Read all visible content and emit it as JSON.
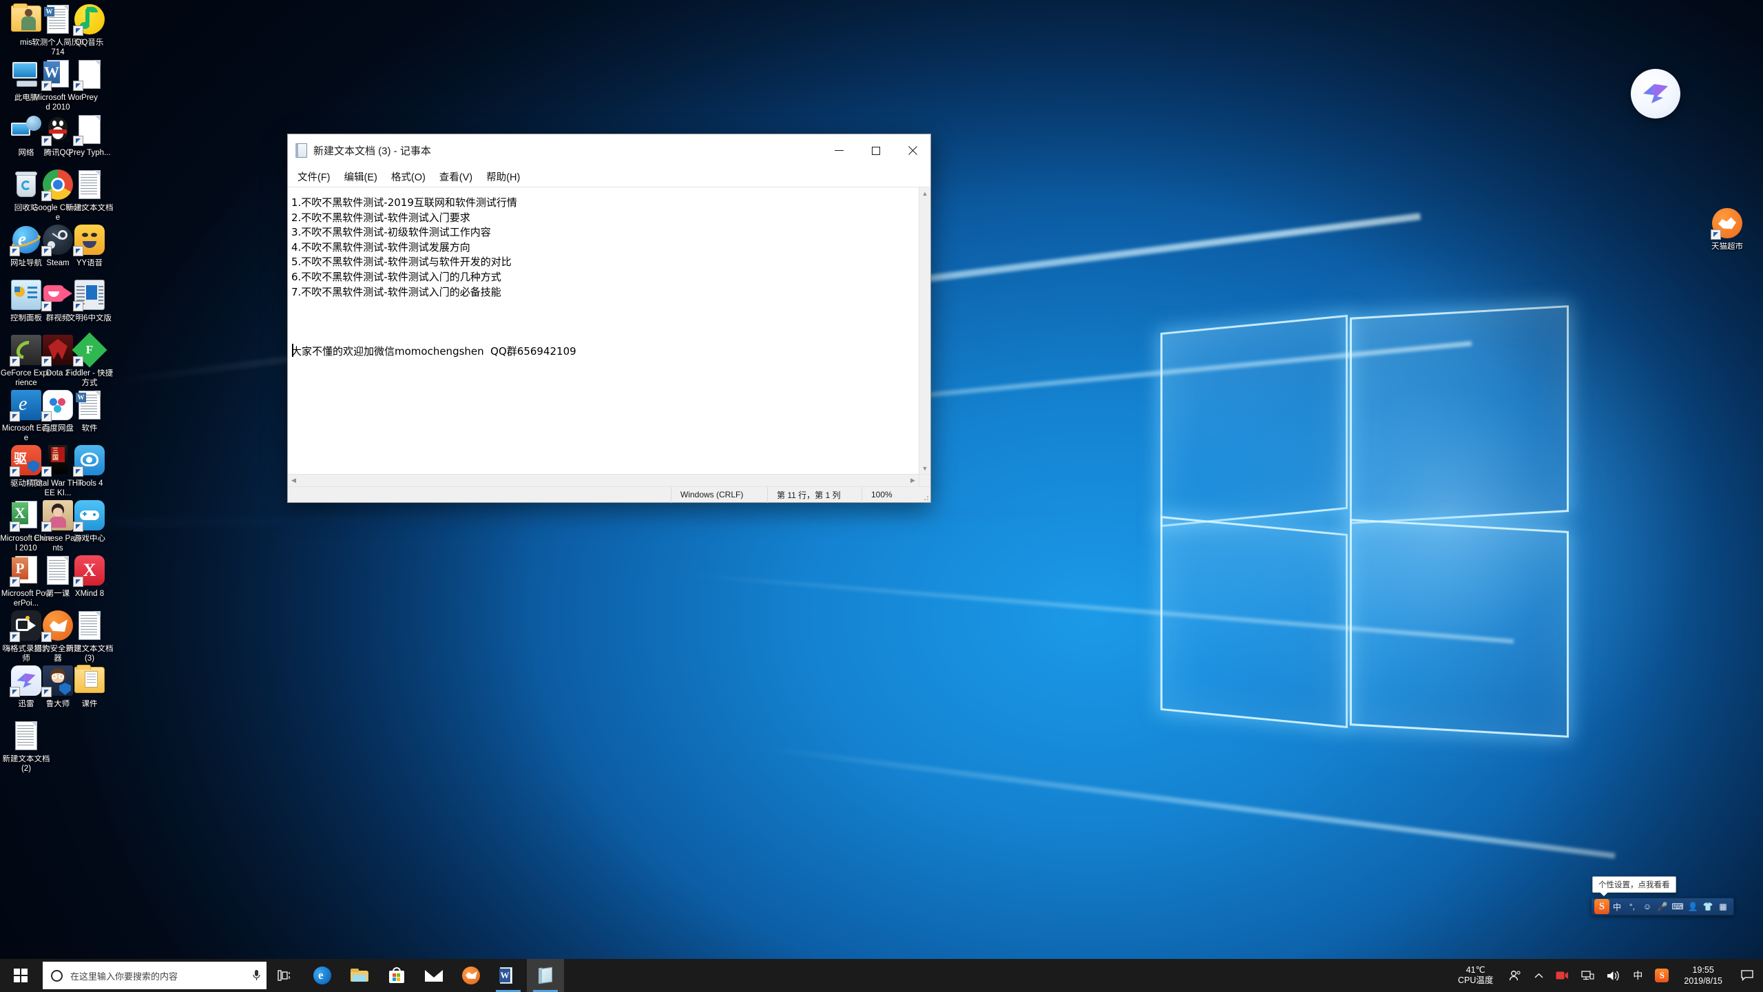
{
  "desktop": {
    "icons": [
      {
        "label": "mis",
        "type": "folder-user"
      },
      {
        "label": "软测个人简历0714",
        "type": "word-doc"
      },
      {
        "label": "QQ音乐",
        "type": "qqmusic",
        "shortcut": true
      },
      {
        "label": "此电脑",
        "type": "this-pc"
      },
      {
        "label": "Microsoft Word 2010",
        "type": "word-app",
        "shortcut": true
      },
      {
        "label": "Prey",
        "type": "blank-doc",
        "shortcut": true
      },
      {
        "label": "网络",
        "type": "network"
      },
      {
        "label": "腾讯QQ",
        "type": "qq-penguin",
        "shortcut": true
      },
      {
        "label": "Prey Typh...",
        "type": "blank-doc",
        "shortcut": true
      },
      {
        "label": "回收站",
        "type": "recycle-bin"
      },
      {
        "label": "Google Chrome",
        "type": "chrome",
        "shortcut": true
      },
      {
        "label": "新建文本文档",
        "type": "text-doc"
      },
      {
        "label": "网址导航",
        "type": "ie",
        "shortcut": true
      },
      {
        "label": "Steam",
        "type": "steam",
        "shortcut": true
      },
      {
        "label": "YY语音",
        "type": "yy",
        "shortcut": true
      },
      {
        "label": "控制面板",
        "type": "control-panel"
      },
      {
        "label": "群视频",
        "type": "qun-video",
        "shortcut": true
      },
      {
        "label": "文明6中文版",
        "type": "civ6",
        "shortcut": true
      },
      {
        "label": "GeForce Experience",
        "type": "geforce",
        "shortcut": true
      },
      {
        "label": "Dota 2",
        "type": "dota2",
        "shortcut": true
      },
      {
        "label": "Fiddler - 快捷方式",
        "type": "fiddler",
        "shortcut": true
      },
      {
        "label": "Microsoft Edge",
        "type": "edge",
        "shortcut": true
      },
      {
        "label": "百度网盘",
        "type": "baidu-pan",
        "shortcut": true
      },
      {
        "label": "软件",
        "type": "word-doc"
      },
      {
        "label": "驱动精灵",
        "type": "qudong",
        "shortcut": true
      },
      {
        "label": "Total War THREE KI...",
        "type": "totalwar",
        "shortcut": true
      },
      {
        "label": "iTools 4",
        "type": "itools",
        "shortcut": true
      },
      {
        "label": "Microsoft Excel 2010",
        "type": "excel-app",
        "shortcut": true
      },
      {
        "label": "Chinese Parents",
        "type": "chinese-parents",
        "shortcut": true
      },
      {
        "label": "游戏中心",
        "type": "game-center",
        "shortcut": true
      },
      {
        "label": "Microsoft PowerPoi...",
        "type": "ppt-app",
        "shortcut": true
      },
      {
        "label": "第一课",
        "type": "text-doc"
      },
      {
        "label": "XMind 8",
        "type": "xmind",
        "shortcut": true
      },
      {
        "label": "嗨格式录屏大师",
        "type": "haigeshi",
        "shortcut": true
      },
      {
        "label": "猎豹安全浏览器",
        "type": "liebao",
        "shortcut": true
      },
      {
        "label": "新建文本文档 (3)",
        "type": "text-doc"
      },
      {
        "label": "迅雷",
        "type": "xunlei",
        "shortcut": true
      },
      {
        "label": "鲁大师",
        "type": "ludashi",
        "shortcut": true
      },
      {
        "label": "课件",
        "type": "folder-doc"
      },
      {
        "label": "新建文本文档 (2)",
        "type": "text-doc"
      }
    ],
    "right_icons": [
      {
        "label": "天猫超市",
        "type": "tmall",
        "shortcut": true
      }
    ],
    "xunlei_widget_name": "xunlei-floating-widget"
  },
  "notepad": {
    "title": "新建文本文档 (3) - 记事本",
    "menus": [
      {
        "label": "文件(F)"
      },
      {
        "label": "编辑(E)"
      },
      {
        "label": "格式(O)"
      },
      {
        "label": "查看(V)"
      },
      {
        "label": "帮助(H)"
      }
    ],
    "window_controls": {
      "minimize": "最小化",
      "maximize": "最大化",
      "close": "关闭"
    },
    "content": "1.不吹不黑软件测试-2019互联网和软件测试行情\n2.不吹不黑软件测试-软件测试入门要求\n3.不吹不黑软件测试-初级软件测试工作内容\n4.不吹不黑软件测试-软件测试发展方向\n5.不吹不黑软件测试-软件测试与软件开发的对比\n6.不吹不黑软件测试-软件测试入门的几种方式\n7.不吹不黑软件测试-软件测试入门的必备技能\n\n\n\n大家不懂的欢迎加微信momochengshen  QQ群656942109",
    "status_bar": {
      "encoding": "Windows (CRLF)",
      "position": "第 11 行，第 1 列",
      "zoom": "100%"
    }
  },
  "sogou": {
    "tooltip": "个性设置，点我看看",
    "items": [
      {
        "name": "sogou-logo-icon",
        "glyph": "S"
      },
      {
        "name": "ime-mode-chinese",
        "glyph": "中"
      },
      {
        "name": "punctuation-mode-icon",
        "glyph": "°,"
      },
      {
        "name": "emoji-icon",
        "glyph": "☺"
      },
      {
        "name": "voice-input-icon",
        "glyph": "🎤"
      },
      {
        "name": "soft-keyboard-icon",
        "glyph": "⌨"
      },
      {
        "name": "user-icon",
        "glyph": "👤"
      },
      {
        "name": "skin-icon",
        "glyph": "👕"
      },
      {
        "name": "toolbox-icon",
        "glyph": "▦"
      }
    ]
  },
  "taskbar": {
    "start_label": "开始",
    "search_placeholder": "在这里输入你要搜索的内容",
    "mic_name": "microphone-icon",
    "taskview_label": "任务视图",
    "apps": [
      {
        "name": "taskbar-edge",
        "label": "Microsoft Edge",
        "active": false,
        "running": false
      },
      {
        "name": "taskbar-file-explorer",
        "label": "文件资源管理器",
        "active": false,
        "running": false
      },
      {
        "name": "taskbar-microsoft-store",
        "label": "Microsoft Store",
        "active": false,
        "running": false
      },
      {
        "name": "taskbar-mail",
        "label": "邮件",
        "active": false,
        "running": false
      },
      {
        "name": "taskbar-liebao-browser",
        "label": "猎豹浏览器",
        "active": false,
        "running": false
      },
      {
        "name": "taskbar-word",
        "label": "Microsoft Word",
        "active": false,
        "running": true
      },
      {
        "name": "taskbar-notepad",
        "label": "记事本",
        "active": true,
        "running": true
      }
    ],
    "tray": {
      "cpu_temp_value": "41℃",
      "cpu_temp_label": "CPU温度",
      "people_icon": "people-icon",
      "show_hidden_icon": "chevron-up-icon",
      "recorder_icon": "screen-recorder-icon",
      "network_icon": "network-icon",
      "volume_icon": "volume-icon",
      "ime_indicator": "中",
      "sogou_icon": "sogou-tray-icon",
      "time": "19:55",
      "date": "2019/8/15",
      "action_center_icon": "action-center-icon"
    }
  }
}
